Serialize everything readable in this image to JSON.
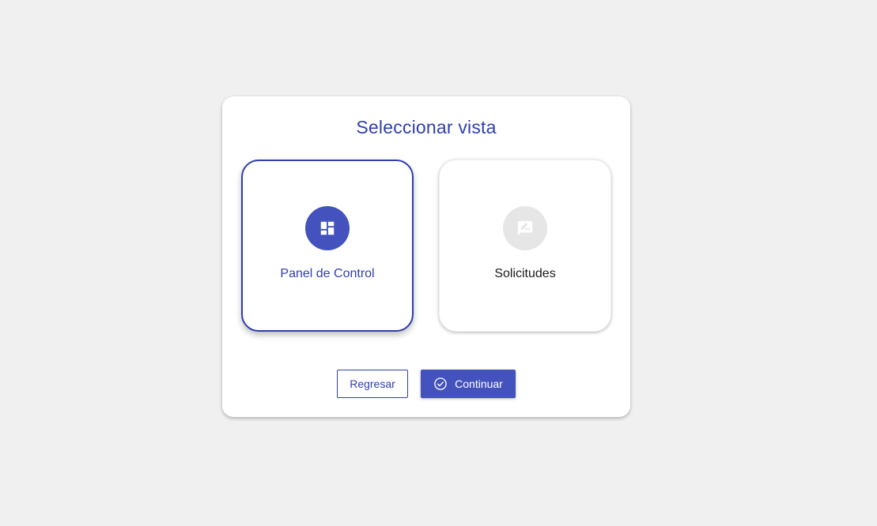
{
  "dialog": {
    "title": "Seleccionar vista",
    "options": [
      {
        "label": "Panel de Control",
        "icon": "dashboard-icon",
        "selected": true
      },
      {
        "label": "Solicitudes",
        "icon": "rate-review-icon",
        "selected": false
      }
    ],
    "actions": {
      "back_label": "Regresar",
      "continue_label": "Continuar",
      "continue_icon": "check-circle-icon"
    }
  },
  "colors": {
    "background": "#f0f0f0",
    "primary": "#2f3fad",
    "primary_fill": "#4352bd",
    "inactive_icon_bg": "#e6e6e6",
    "text_dark": "#1a1a1a"
  }
}
